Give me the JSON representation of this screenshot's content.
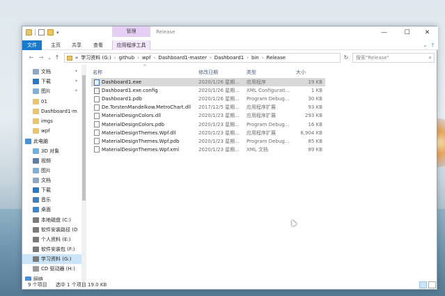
{
  "titlebar": {
    "manage_tab": "管理",
    "window_title": "Release",
    "minimize": "—",
    "maximize": "☐",
    "close": "✕"
  },
  "ribbon": {
    "tabs": [
      "文件",
      "主页",
      "共享",
      "查看",
      "应用程序工具"
    ],
    "chevron": "⌄",
    "help": "?"
  },
  "address": {
    "back": "←",
    "forward": "→",
    "recent": "⌄",
    "up": "↑",
    "prefix": "«",
    "crumbs": [
      "学习资料 (G:)",
      "github",
      "wpf",
      "Dashboard1-master",
      "Dashboard1",
      "bin",
      "Release"
    ],
    "dropdown": "⌄",
    "refresh": "↻",
    "search_placeholder": "搜索\"Release\""
  },
  "nav": {
    "items": [
      {
        "label": "文档",
        "icon": "documents-icon",
        "color": "#8ea7c6",
        "pinned": true
      },
      {
        "label": "下载",
        "icon": "download-icon",
        "color": "#2b78c6",
        "pinned": true
      },
      {
        "label": "图片",
        "icon": "pictures-icon",
        "color": "#7fb0d8",
        "pinned": true
      },
      {
        "label": "01",
        "icon": "folder-icon",
        "color": "#e9c46a",
        "pinned": false
      },
      {
        "label": "Dashboard1-m",
        "icon": "folder-icon",
        "color": "#e9c46a",
        "pinned": false
      },
      {
        "label": "imgs",
        "icon": "folder-icon",
        "color": "#e9c46a",
        "pinned": false
      },
      {
        "label": "wpf",
        "icon": "folder-icon",
        "color": "#e9c46a",
        "pinned": false
      },
      {
        "label": "此电脑",
        "icon": "pc-icon",
        "color": "#4a8fd6",
        "pinned": false
      },
      {
        "label": "3D 对象",
        "icon": "3d-objects-icon",
        "color": "#6fb2e0",
        "pinned": false
      },
      {
        "label": "视频",
        "icon": "videos-icon",
        "color": "#5d7fa8",
        "pinned": false
      },
      {
        "label": "图片",
        "icon": "pictures-icon",
        "color": "#7fb0d8",
        "pinned": false
      },
      {
        "label": "文档",
        "icon": "documents-icon",
        "color": "#8ea7c6",
        "pinned": false
      },
      {
        "label": "下载",
        "icon": "download-icon",
        "color": "#2b78c6",
        "pinned": false
      },
      {
        "label": "音乐",
        "icon": "music-icon",
        "color": "#3f7fc0",
        "pinned": false
      },
      {
        "label": "桌面",
        "icon": "desktop-icon",
        "color": "#3b86d0",
        "pinned": false
      },
      {
        "label": "本地磁盘 (C:)",
        "icon": "drive-icon",
        "color": "#7a7a7a",
        "pinned": false
      },
      {
        "label": "软件安装路径 (D",
        "icon": "drive-icon",
        "color": "#7a7a7a",
        "pinned": false
      },
      {
        "label": "个人资料 (E:)",
        "icon": "drive-icon",
        "color": "#7a7a7a",
        "pinned": false
      },
      {
        "label": "软件安装包 (F:)",
        "icon": "drive-icon",
        "color": "#7a7a7a",
        "pinned": false
      },
      {
        "label": "学习资料 (G:)",
        "icon": "drive-icon",
        "color": "#7a7a7a",
        "pinned": false,
        "selected": true
      },
      {
        "label": "CD 驱动器 (H:)",
        "icon": "cd-drive-icon",
        "color": "#9a9a9a",
        "pinned": false
      },
      {
        "label": "网络",
        "icon": "network-icon",
        "color": "#4a8fd6",
        "pinned": false
      }
    ]
  },
  "columns": {
    "name": "名称",
    "date": "修改日期",
    "type": "类型",
    "size": "大小",
    "sort_indicator": "^"
  },
  "files": [
    {
      "name": "Dashboard1.exe",
      "date": "2020/1/26 星期...",
      "type": "应用程序",
      "size": "19 KB",
      "icon": "exe-icon",
      "selected": true
    },
    {
      "name": "Dashboard1.exe.config",
      "date": "2020/1/26 星期...",
      "type": "XML Configurati...",
      "size": "1 KB",
      "icon": "config-file-icon"
    },
    {
      "name": "Dashboard1.pdb",
      "date": "2020/1/26 星期...",
      "type": "Program Debug...",
      "size": "30 KB",
      "icon": "file-icon"
    },
    {
      "name": "De.TorstenMandelkow.MetroChart.dll",
      "date": "2017/12/5 星期...",
      "type": "应用程序扩展",
      "size": "93 KB",
      "icon": "dll-icon"
    },
    {
      "name": "MaterialDesignColors.dll",
      "date": "2020/1/23 星期...",
      "type": "应用程序扩展",
      "size": "293 KB",
      "icon": "dll-icon"
    },
    {
      "name": "MaterialDesignColors.pdb",
      "date": "2020/1/23 星期...",
      "type": "Program Debug...",
      "size": "16 KB",
      "icon": "file-icon"
    },
    {
      "name": "MaterialDesignThemes.Wpf.dll",
      "date": "2020/1/23 星期...",
      "type": "应用程序扩展",
      "size": "6,904 KB",
      "icon": "dll-icon"
    },
    {
      "name": "MaterialDesignThemes.Wpf.pdb",
      "date": "2020/1/23 星期...",
      "type": "Program Debug...",
      "size": "85 KB",
      "icon": "file-icon"
    },
    {
      "name": "MaterialDesignThemes.Wpf.xml",
      "date": "2020/1/23 星期...",
      "type": "XML 文档",
      "size": "89 KB",
      "icon": "file-icon"
    }
  ],
  "status": {
    "count": "9 个项目",
    "selection": "选中 1 个项目  19.0 KB"
  }
}
